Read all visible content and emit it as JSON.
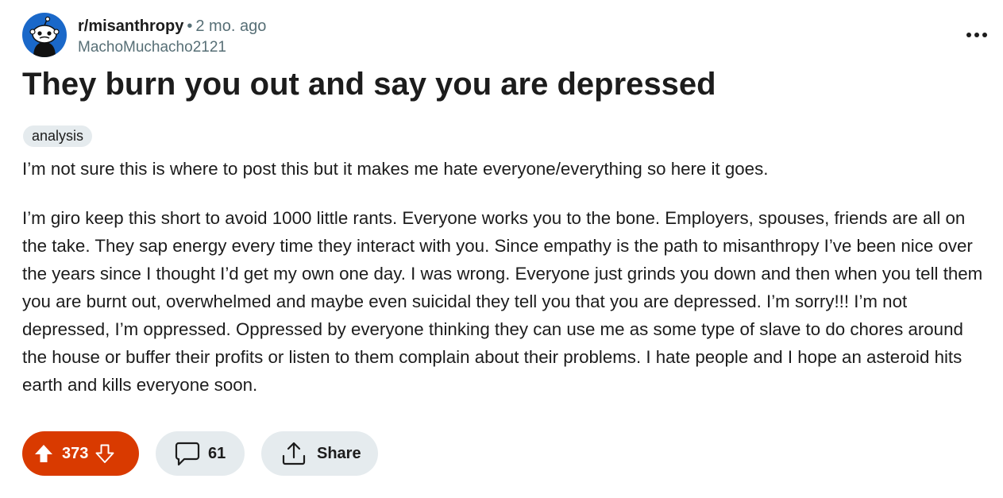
{
  "post": {
    "subreddit": "r/misanthropy",
    "separator": "•",
    "time_ago": "2 mo. ago",
    "author": "MachoMuchacho2121",
    "title": "They burn you out and say you are depressed",
    "flair": "analysis",
    "paragraphs": [
      "I’m not sure this is where to post this but it makes me hate everyone/everything so here it goes.",
      "I’m giro keep this short to avoid 1000 little rants. Everyone works you to the bone. Employers, spouses, friends are all on the take. They sap energy every time they interact with you. Since empathy is the path to misanthropy I’ve been nice over the years since I thought I’d get my own one day. I was wrong. Everyone just grinds you down and then when you tell them you are burnt out, overwhelmed and maybe even suicidal they tell you that you are depressed. I’m sorry!!! I’m not depressed, I’m oppressed. Oppressed by everyone thinking they can use me as some type of slave to do chores around the house or buffer their profits or listen to them complain about their problems. I hate people and I hope an asteroid hits earth and kills everyone soon."
    ]
  },
  "actions": {
    "vote_count": "373",
    "comment_count": "61",
    "share_label": "Share"
  },
  "icons": {
    "avatar": "subreddit-avatar-icon",
    "overflow": "more-options-icon",
    "upvote": "upvote-arrow-icon",
    "downvote": "downvote-arrow-icon",
    "comment": "comment-bubble-icon",
    "share": "share-icon"
  },
  "colors": {
    "vote_active_bg": "#d93a00",
    "pill_bg": "#e5ebee",
    "avatar_bg": "#1a68c9",
    "muted_text": "#576f76"
  }
}
